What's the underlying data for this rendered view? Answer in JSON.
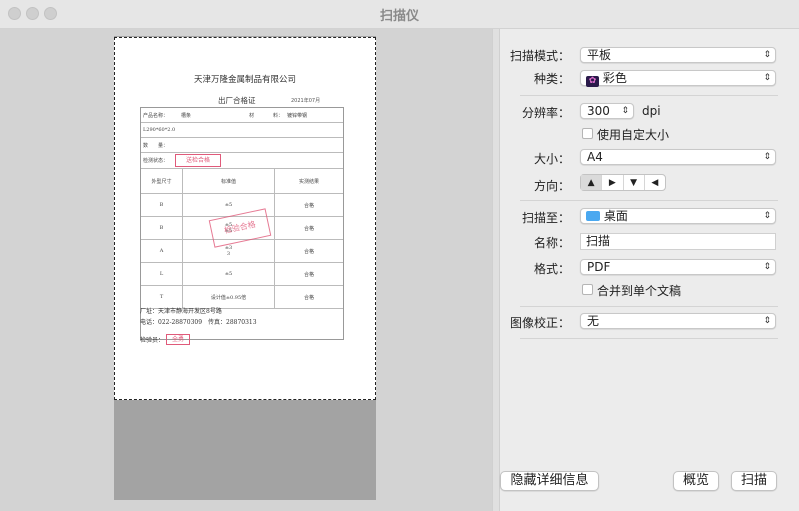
{
  "window": {
    "title": "扫描仪"
  },
  "document": {
    "company": "天津万隆金属制品有限公司",
    "cert_title": "出厂合格证",
    "cert_date": "2021年07月",
    "product_row": {
      "name_label": "产品名称：",
      "name_value": "槽条",
      "material_label": "材",
      "material_suffix": "料：",
      "material_value": "镀锌带钢"
    },
    "spec_row": "L290*60*2.0",
    "quantity_row": "数　　量：",
    "inspection_row": "检测状态：",
    "inspection_stamp": "送检合格",
    "table_header": [
      "外型尺寸",
      "标准值",
      "实测结果"
    ],
    "table_rows": [
      {
        "dim": "B",
        "std": "±5",
        "result": "合格"
      },
      {
        "dim": "B",
        "std": "±5\n±5",
        "result": "合格"
      },
      {
        "dim": "A",
        "std": "±3\n3",
        "result": "合格"
      },
      {
        "dim": "L",
        "std": "±5",
        "result": "合格"
      },
      {
        "dim": "T",
        "std": "设计值±0.95倍",
        "result": "合格"
      }
    ],
    "qc_stamp": "检验合格",
    "address": "厂址：天津市静海开发区8号路",
    "phone": "电话：022-28870309　传真：28870313",
    "inspector_label": "检验员：",
    "inspector_stamp": "全勇"
  },
  "settings": {
    "mode": {
      "label": "扫描模式：",
      "value": "平板"
    },
    "kind": {
      "label": "种类：",
      "value": "彩色"
    },
    "resolution": {
      "label": "分辨率：",
      "value": "300",
      "unit": "dpi"
    },
    "custom_size": {
      "label": "使用自定大小",
      "checked": false
    },
    "size": {
      "label": "大小：",
      "value": "A4"
    },
    "orientation": {
      "label": "方向：",
      "options": [
        "portrait",
        "landscape-left",
        "upside-down",
        "landscape-right"
      ],
      "selected": 0
    },
    "scan_to": {
      "label": "扫描至：",
      "value": "桌面"
    },
    "name": {
      "label": "名称：",
      "value": "扫描"
    },
    "format": {
      "label": "格式：",
      "value": "PDF"
    },
    "combine": {
      "label": "合并到单个文稿",
      "checked": false
    },
    "correction": {
      "label": "图像校正：",
      "value": "无"
    }
  },
  "buttons": {
    "hide_details": "隐藏详细信息",
    "overview": "概览",
    "scan": "扫描"
  },
  "colors": {
    "folder": "#4aa8f0",
    "stamp": "#e05a7a"
  },
  "icons": {
    "chevron": "chevron-updown-icon"
  }
}
